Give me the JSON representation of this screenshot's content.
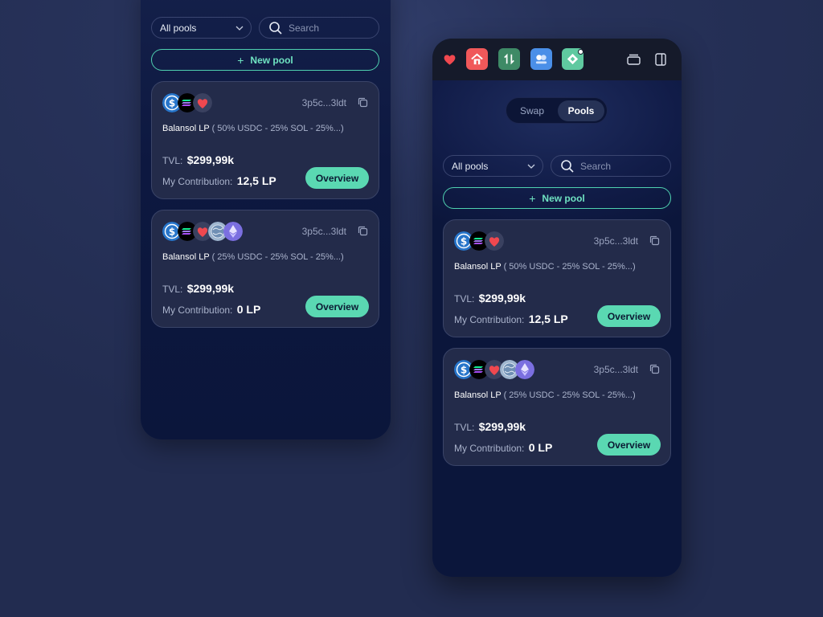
{
  "topbar": {
    "apps": [
      "heart-app",
      "home-app",
      "transfer-app",
      "toggle-app",
      "diamond-app"
    ],
    "window_icons": [
      "stack-windows-icon",
      "sidebar-panel-icon"
    ]
  },
  "tabs": [
    {
      "label": "Swap",
      "active": false
    },
    {
      "label": "Pools",
      "active": true
    }
  ],
  "filter": {
    "select_value": "All pools",
    "search_placeholder": "Search"
  },
  "new_pool_label": "New pool",
  "pools": [
    {
      "tokens": [
        "usdc",
        "sol",
        "heart"
      ],
      "address": "3p5c...3ldt",
      "name": "Balansol LP",
      "composition": "( 50% USDC - 25% SOL - 25%...)",
      "tvl_label": "TVL:",
      "tvl": "$299,99k",
      "contribution_label": "My Contribution:",
      "contribution": "12,5 LP",
      "action": "Overview"
    },
    {
      "tokens": [
        "usdc",
        "sol",
        "heart",
        "globe",
        "eth"
      ],
      "address": "3p5c...3ldt",
      "name": "Balansol LP",
      "composition": "( 25% USDC - 25% SOL - 25%...)",
      "tvl_label": "TVL:",
      "tvl": "$299,99k",
      "contribution_label": "My Contribution:",
      "contribution": "0 LP",
      "action": "Overview"
    }
  ],
  "colors": {
    "accent": "#5ad8b2",
    "panel": "#0b163b",
    "card": "#232b4a",
    "heart": "#f0484f"
  }
}
